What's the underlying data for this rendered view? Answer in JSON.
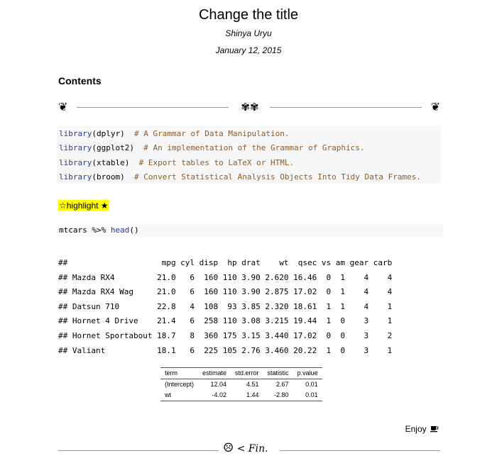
{
  "header": {
    "title": "Change the title",
    "author": "Shinya Uryu",
    "date": "January 12, 2015"
  },
  "toc": {
    "heading": "Contents"
  },
  "ornaments": {
    "left": "❦",
    "center": "✾✾",
    "right": "❦"
  },
  "code_library": [
    {
      "fn": "library",
      "arg": "(dplyr)",
      "comment": "  # A Grammar of Data Manipulation."
    },
    {
      "fn": "library",
      "arg": "(ggplot2)",
      "comment": "  # An implementation of the Grammar of Graphics."
    },
    {
      "fn": "library",
      "arg": "(xtable)",
      "comment": "  # Export tables to LaTeX or HTML."
    },
    {
      "fn": "library",
      "arg": "(broom)",
      "comment": "  # Convert Statistical Analysis Objects Into Tidy Data Frames."
    }
  ],
  "highlight": {
    "text": "☆highlight ★"
  },
  "code_head": {
    "pre": "mtcars %>% ",
    "fn": "head",
    "post": "()"
  },
  "output": [
    "##                    mpg cyl disp  hp drat    wt  qsec vs am gear carb",
    "## Mazda RX4         21.0   6  160 110 3.90 2.620 16.46  0  1    4    4",
    "## Mazda RX4 Wag     21.0   6  160 110 3.90 2.875 17.02  0  1    4    4",
    "## Datsun 710        22.8   4  108  93 3.85 2.320 18.61  1  1    4    1",
    "## Hornet 4 Drive    21.4   6  258 110 3.08 3.215 19.44  1  0    3    1",
    "## Hornet Sportabout 18.7   8  360 175 3.15 3.440 17.02  0  0    3    2",
    "## Valiant           18.1   6  225 105 2.76 3.460 20.22  1  0    3    1"
  ],
  "table": {
    "headers": [
      "term",
      "estimate",
      "std.error",
      "statistic",
      "p.value"
    ],
    "rows": [
      [
        "(Intercept)",
        "12.04",
        "4.51",
        "2.67",
        "0.01"
      ],
      [
        "wt",
        "-4.02",
        "1.44",
        "-2.80",
        "0.01"
      ]
    ]
  },
  "footer": {
    "enjoy": "Enjoy",
    "enjoy_icon": "coffee-icon",
    "fin_face": "☹",
    "fin_text": " < Fin."
  }
}
